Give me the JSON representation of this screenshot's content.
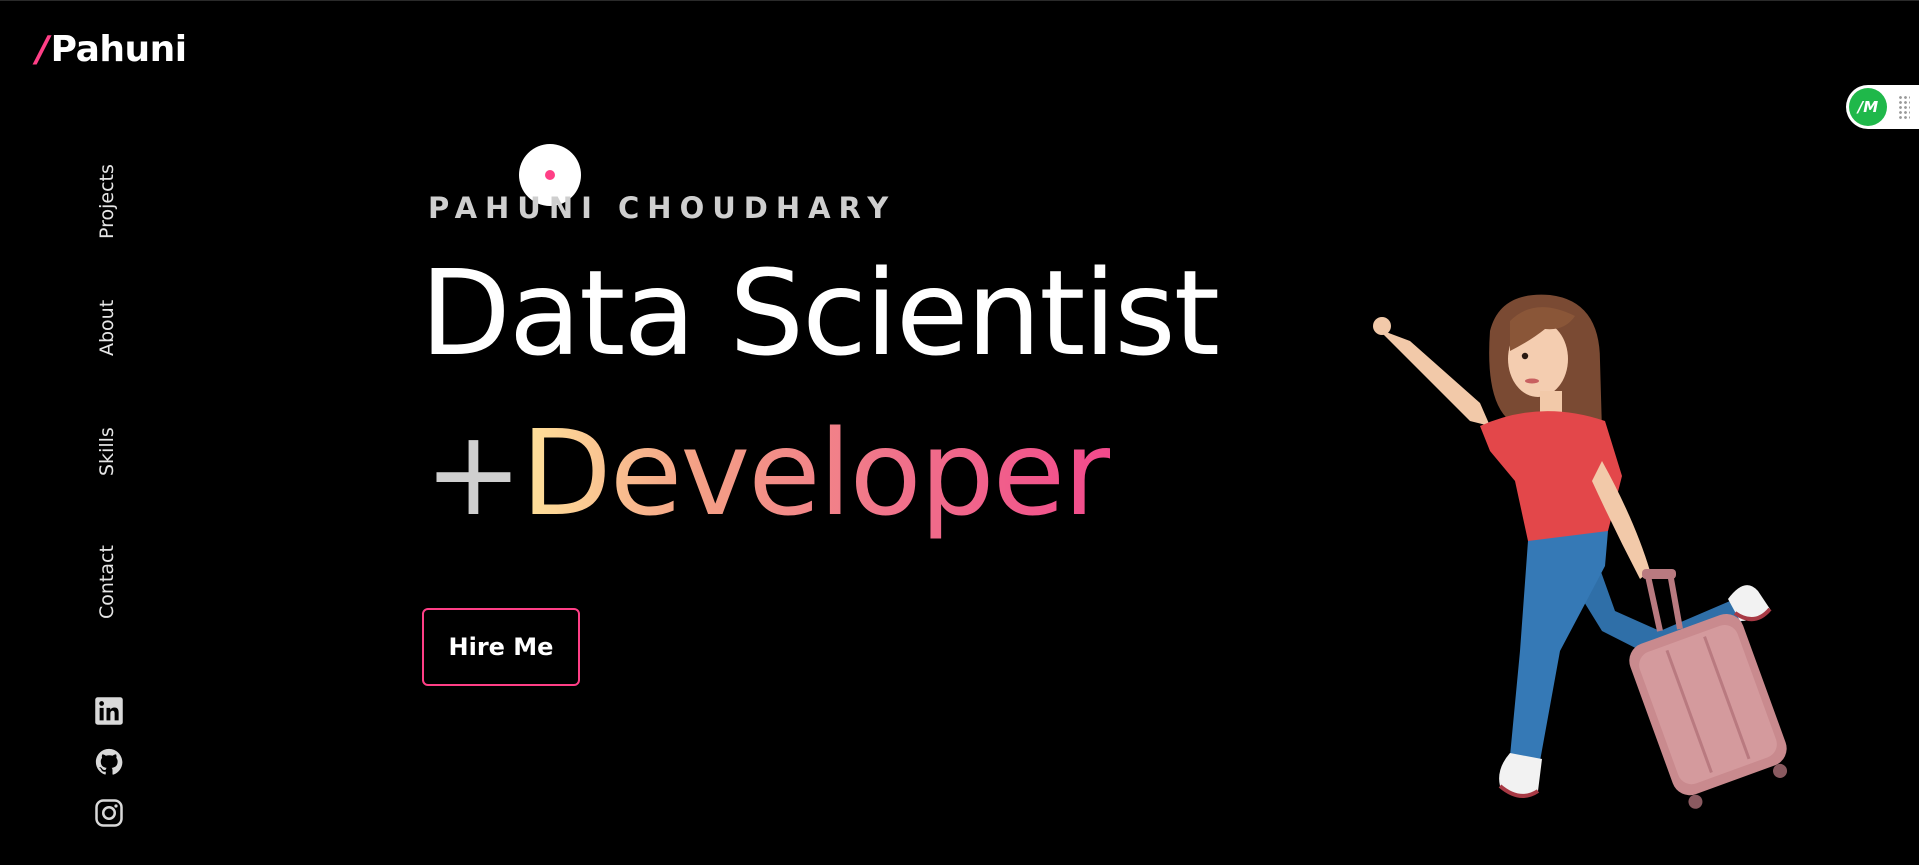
{
  "logo": {
    "slash": "/",
    "name": "Pahuni"
  },
  "nav": {
    "items": [
      {
        "label": "Projects"
      },
      {
        "label": "About"
      },
      {
        "label": "Skills"
      },
      {
        "label": "Contact"
      }
    ]
  },
  "social": {
    "items": [
      {
        "icon": "linkedin-icon"
      },
      {
        "icon": "github-icon"
      },
      {
        "icon": "instagram-icon"
      }
    ]
  },
  "hero": {
    "eyebrow": "PAHUNI CHOUDHARY",
    "headline_line1": "Data Scientist",
    "headline_plus": "+",
    "headline_line2": "Developer",
    "cta_label": "Hire Me"
  },
  "extension": {
    "logo_text": "/M"
  },
  "colors": {
    "background": "#000000",
    "accent": "#ff3f86",
    "gradient_start": "#ffe29a",
    "gradient_end": "#f24a8c",
    "extension_green": "#1fb84a"
  }
}
